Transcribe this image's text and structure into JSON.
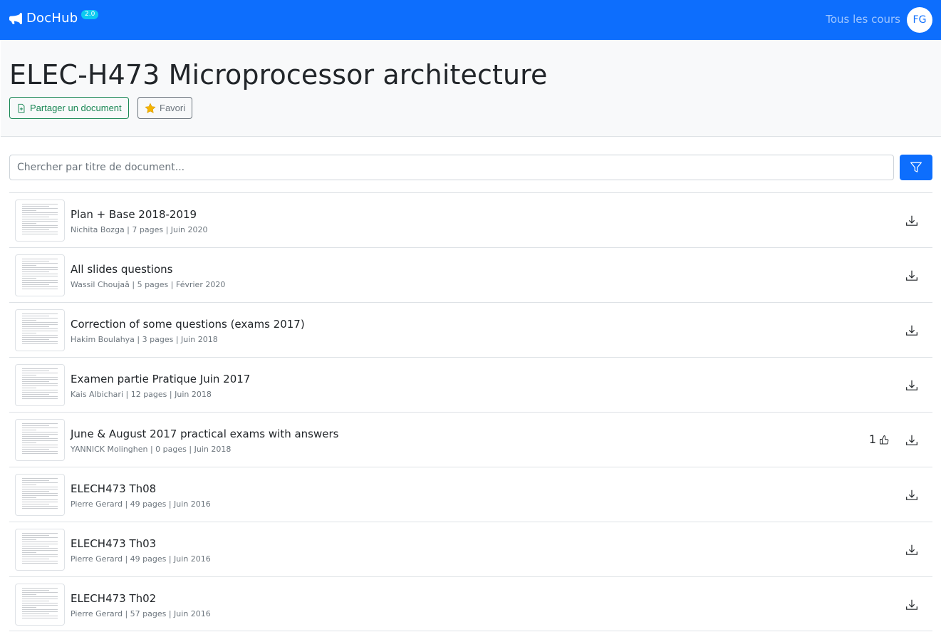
{
  "navbar": {
    "brand": "DocHub",
    "badge": "2.0",
    "courses_link": "Tous les cours",
    "avatar_initials": "FG",
    "bg_color": "#0d6efd"
  },
  "header": {
    "title": "ELEC-H473 Microprocessor architecture",
    "share_button": "Partager un document",
    "favorite_button": "Favori"
  },
  "search": {
    "placeholder": "Chercher par titre de document...",
    "filter_icon": "funnel-icon"
  },
  "documents": [
    {
      "title": "Plan + Base 2018-2019",
      "meta": "Nichita Bozga | 7 pages | Juin 2020",
      "likes": ""
    },
    {
      "title": "All slides questions",
      "meta": "Wassil Choujaâ | 5 pages | Février 2020",
      "likes": ""
    },
    {
      "title": "Correction of some questions (exams 2017)",
      "meta": "Hakim Boulahya | 3 pages | Juin 2018",
      "likes": ""
    },
    {
      "title": "Examen partie Pratique Juin 2017",
      "meta": "Kais Albichari | 12 pages | Juin 2018",
      "likes": ""
    },
    {
      "title": "June & August 2017 practical exams with answers",
      "meta": "YANNICK Molinghen | 0 pages | Juin 2018",
      "likes": "1"
    },
    {
      "title": "ELECH473 Th08",
      "meta": "Pierre Gerard | 49 pages | Juin 2016",
      "likes": ""
    },
    {
      "title": "ELECH473 Th03",
      "meta": "Pierre Gerard | 49 pages | Juin 2016",
      "likes": ""
    },
    {
      "title": "ELECH473 Th02",
      "meta": "Pierre Gerard | 57 pages | Juin 2016",
      "likes": ""
    }
  ]
}
